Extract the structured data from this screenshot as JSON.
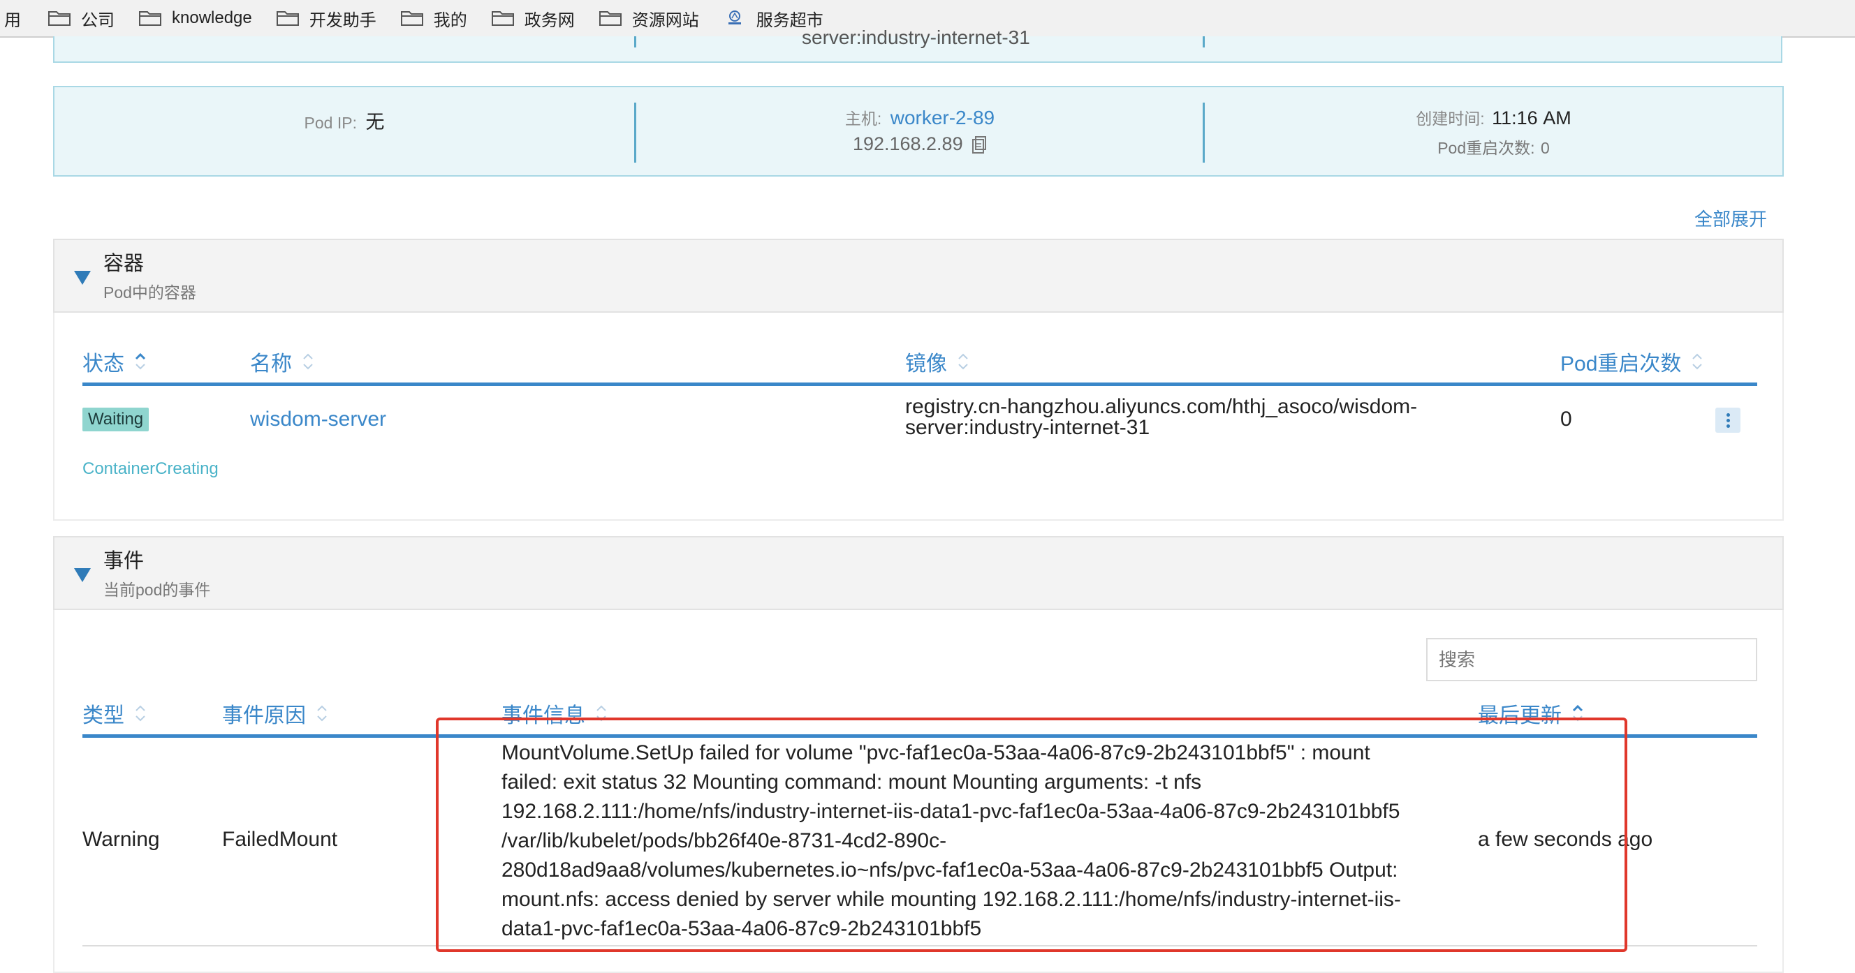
{
  "bookmarks": {
    "leading_fragment": "用",
    "items": [
      {
        "label": "公司",
        "icon": "folder-icon"
      },
      {
        "label": "knowledge",
        "icon": "folder-icon"
      },
      {
        "label": "开发助手",
        "icon": "folder-icon"
      },
      {
        "label": "我的",
        "icon": "folder-icon"
      },
      {
        "label": "政务网",
        "icon": "folder-icon"
      },
      {
        "label": "资源网站",
        "icon": "folder-icon"
      },
      {
        "label": "服务超市",
        "icon": "site-logo-icon"
      }
    ]
  },
  "top_cut": {
    "text": "server:industry-internet-31"
  },
  "pod_info": {
    "pod_ip_label": "Pod IP:",
    "pod_ip_value": "无",
    "host_label": "主机:",
    "host_value": "worker-2-89",
    "host_ip": "192.168.2.89",
    "created_label": "创建时间:",
    "created_value": "11:16 AM",
    "restart_label": "Pod重启次数:",
    "restart_value": "0"
  },
  "expand_all": "全部展开",
  "containers": {
    "title": "容器",
    "desc": "Pod中的容器",
    "columns": [
      "状态",
      "名称",
      "镜像",
      "Pod重启次数"
    ],
    "rows": [
      {
        "status": "Waiting",
        "status_reason": "ContainerCreating",
        "name": "wisdom-server",
        "image_line1": "registry.cn-hangzhou.aliyuncs.com/hthj_asoco/wisdom-",
        "image_line2": "server:industry-internet-31",
        "restarts": "0"
      }
    ]
  },
  "events": {
    "title": "事件",
    "desc": "当前pod的事件",
    "search_placeholder": "搜索",
    "columns": [
      "类型",
      "事件原因",
      "事件信息",
      "最后更新"
    ],
    "rows": [
      {
        "type": "Warning",
        "reason": "FailedMount",
        "message_lines": [
          "MountVolume.SetUp failed for volume \"pvc-faf1ec0a-53aa-4a06-87c9-2b243101bbf5\" : mount",
          "failed: exit status 32 Mounting command: mount Mounting arguments: -t nfs",
          "192.168.2.111:/home/nfs/industry-internet-iis-data1-pvc-faf1ec0a-53aa-4a06-87c9-2b243101bbf5",
          "/var/lib/kubelet/pods/bb26f40e-8731-4cd2-890c-",
          "280d18ad9aa8/volumes/kubernetes.io~nfs/pvc-faf1ec0a-53aa-4a06-87c9-2b243101bbf5 Output:",
          "mount.nfs: access denied by server while mounting 192.168.2.111:/home/nfs/industry-internet-iis-",
          "data1-pvc-faf1ec0a-53aa-4a06-87c9-2b243101bbf5"
        ],
        "last_updated": "a few seconds ago"
      }
    ]
  },
  "colors": {
    "accent": "#3a87c9",
    "info_bg": "#eaf6f9",
    "highlight_red": "#e0372b",
    "badge_bg": "#8fd5cf"
  }
}
